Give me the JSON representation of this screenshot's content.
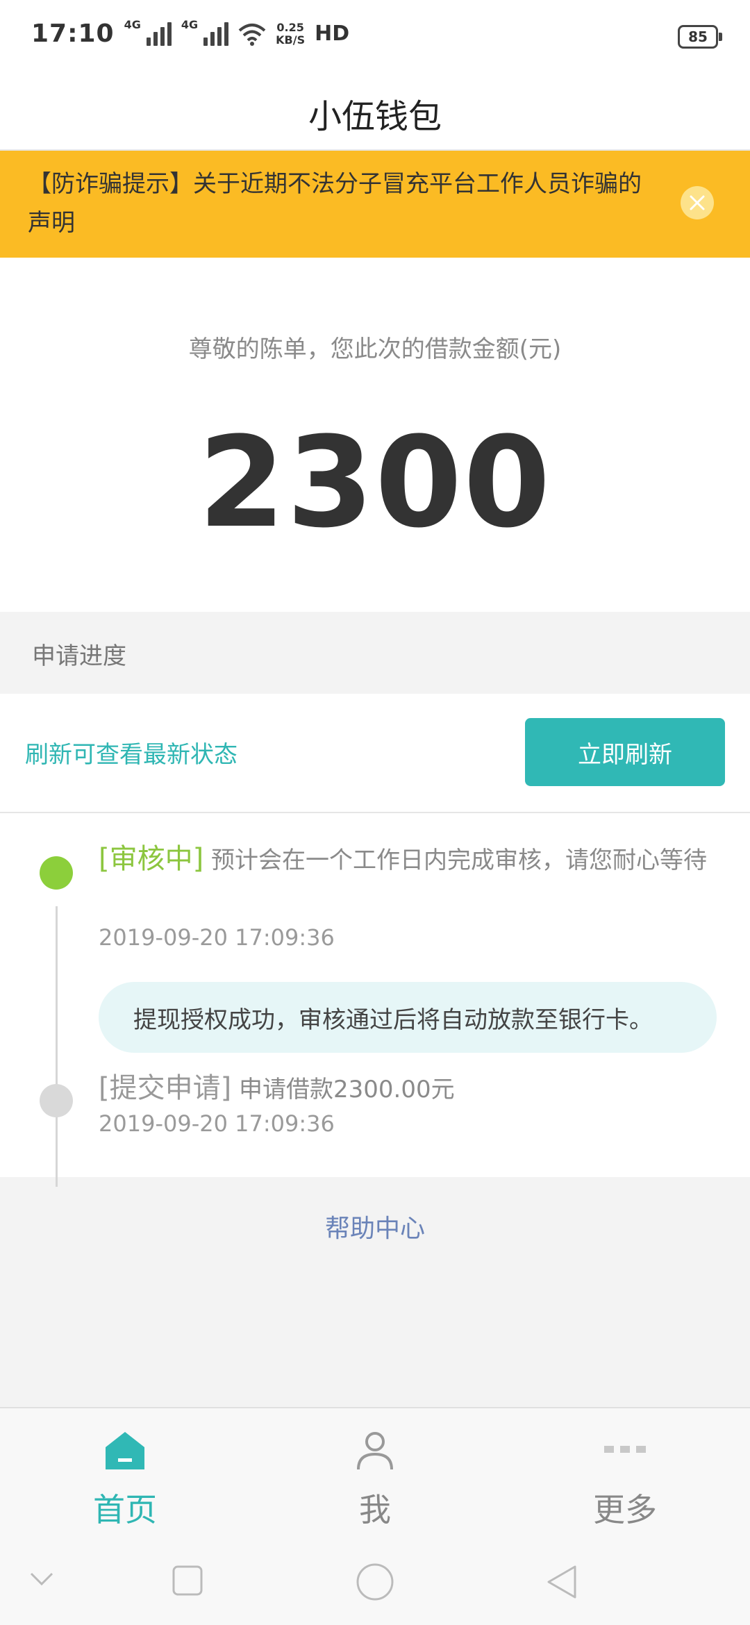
{
  "status_bar": {
    "time": "17:10",
    "network_tag_1": "4G",
    "network_tag_2": "4G",
    "speed_value": "0.25",
    "speed_unit": "KB/S",
    "hd_label": "HD",
    "battery": "85"
  },
  "header": {
    "title": "小伍钱包"
  },
  "notice": {
    "text": "【防诈骗提示】关于近期不法分子冒充平台工作人员诈骗的声明",
    "background": "#fbbb24"
  },
  "loan": {
    "label": "尊敬的陈单，您此次的借款金额(元)",
    "amount": "2300"
  },
  "progress": {
    "section_title": "申请进度",
    "refresh_hint": "刷新可查看最新状态",
    "refresh_button": "立即刷新",
    "accent": "#30b8b5"
  },
  "timeline": [
    {
      "tag": "[审核中]",
      "text": " 预计会在一个工作日内完成审核，请您耐心等待",
      "time": "2019-09-20 17:09:36",
      "note": "提现授权成功，审核通过后将自动放款至银行卡。"
    },
    {
      "tag": "[提交申请]",
      "text": " 申请借款2300.00元",
      "time": "2019-09-20 17:09:36"
    }
  ],
  "help": {
    "label": "帮助中心"
  },
  "bottom_nav": {
    "items": [
      {
        "label": "首页",
        "icon": "home-icon",
        "active": true
      },
      {
        "label": "我",
        "icon": "user-icon",
        "active": false
      },
      {
        "label": "更多",
        "icon": "more-icon",
        "active": false
      }
    ]
  }
}
